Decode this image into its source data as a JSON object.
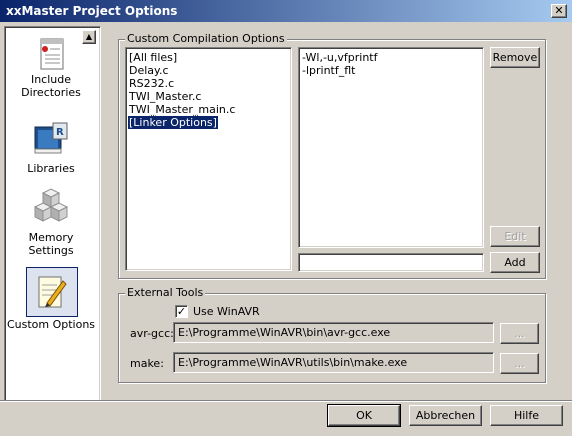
{
  "window": {
    "title": "xxMaster Project Options",
    "close_label": "✕"
  },
  "sidebar": {
    "scroll_up_label": "▲",
    "items": [
      {
        "label_line1": "Include",
        "label_line2": "Directories"
      },
      {
        "label_line1": "Libraries",
        "label_line2": ""
      },
      {
        "label_line1": "Memory",
        "label_line2": "Settings"
      },
      {
        "label_line1": "Custom Options",
        "label_line2": ""
      }
    ]
  },
  "custom_compilation": {
    "group_label": "Custom Compilation Options",
    "files": [
      "[All files]",
      "Delay.c",
      "RS232.c",
      "TWI_Master.c",
      "TWI_Master_main.c",
      "[Linker Options]"
    ],
    "selected_file": "[Linker Options]",
    "options": [
      "-Wl,-u,vfprintf",
      "-lprintf_flt"
    ],
    "remove_label": "Remove",
    "edit_label": "Edit",
    "add_label": "Add",
    "new_option_value": ""
  },
  "external_tools": {
    "group_label": "External Tools",
    "use_winavr_label": "Use WinAVR",
    "use_winavr_checked": "✓",
    "avr_gcc_label": "avr-gcc:",
    "avr_gcc_path": "E:\\Programme\\WinAVR\\bin\\avr-gcc.exe",
    "make_label": "make:",
    "make_path": "E:\\Programme\\WinAVR\\utils\\bin\\make.exe",
    "browse_label": "..."
  },
  "footer": {
    "ok_label": "OK",
    "cancel_label": "Abbrechen",
    "help_label": "Hilfe"
  }
}
